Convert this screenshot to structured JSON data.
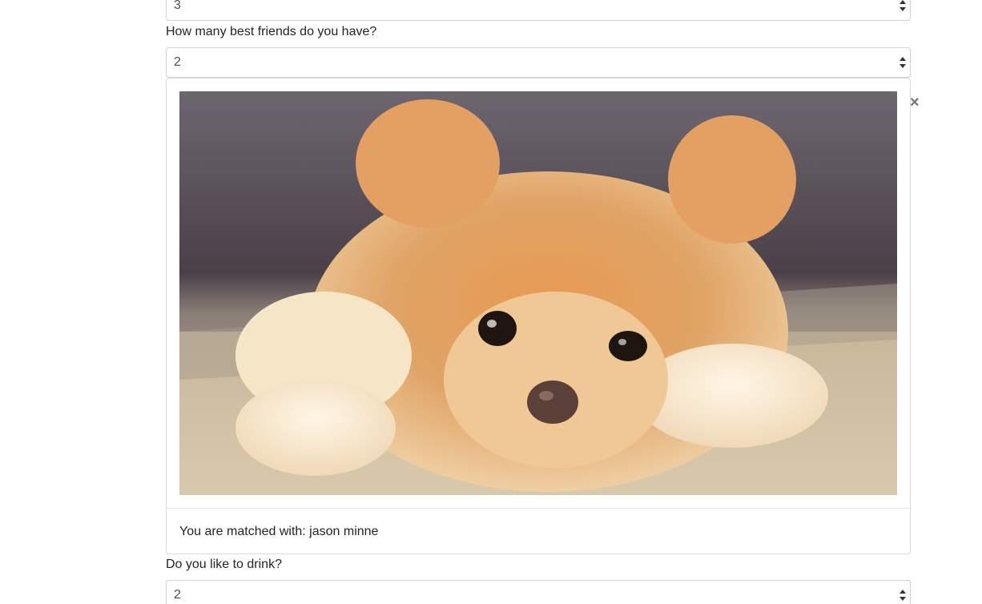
{
  "questions": {
    "prev_select_value": "3",
    "best_friends": {
      "label": "How many best friends do you have?",
      "value": "2"
    },
    "drink": {
      "label": "Do you like to drink?",
      "value": "2"
    }
  },
  "match_modal": {
    "image_subject": "pomeranian-puppy",
    "match_text": "You are matched with: jason minne",
    "close_glyph": "×"
  },
  "colors": {
    "border": "#ced4da",
    "text": "#212529",
    "close": "#6c757d"
  }
}
